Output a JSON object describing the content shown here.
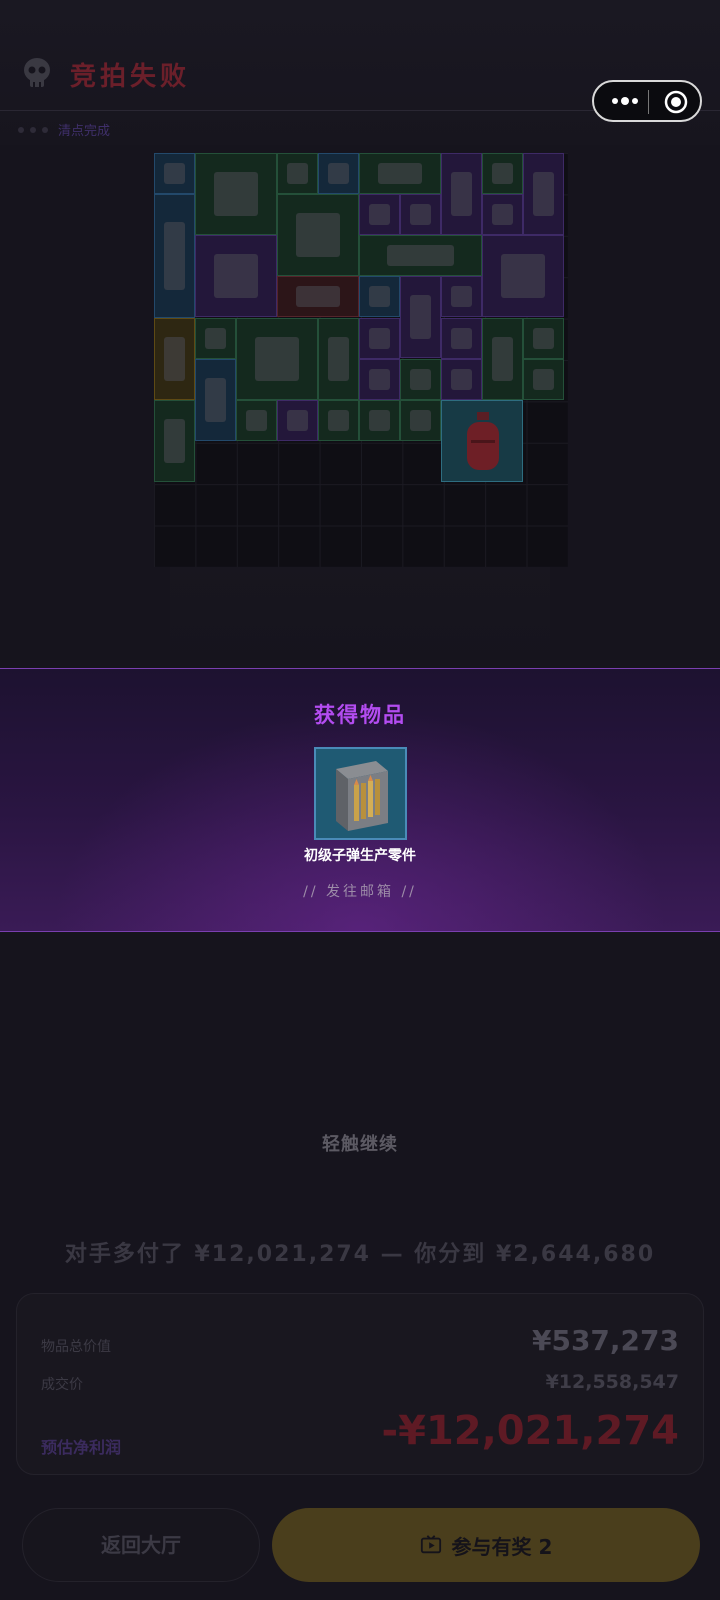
{
  "header": {
    "title": "竞拍失败",
    "status_text": "清点完成"
  },
  "capsule": {
    "more_icon": "more-dots-icon",
    "close_icon": "target-close-icon"
  },
  "reward": {
    "title": "获得物品",
    "item_name": "初级子弹生产零件",
    "destination": "// 发往邮箱 //"
  },
  "tap_hint": "轻触继续",
  "summary": {
    "headline": "对手多付了 ¥12,021,274 — 你分到 ¥2,644,680",
    "total_value_label": "物品总价值",
    "total_value": "¥537,273",
    "deal_price_label": "成交价",
    "deal_price": "¥12,558,547",
    "profit_label": "预估净利润",
    "profit_value": "-¥12,021,274"
  },
  "buttons": {
    "back_label": "返回大厅",
    "join_label": "参与有奖 2"
  },
  "colors": {
    "accent_purple": "#b34cf0",
    "loss_red": "#6b1f2a",
    "join_gold": "#4a3e1c"
  }
}
